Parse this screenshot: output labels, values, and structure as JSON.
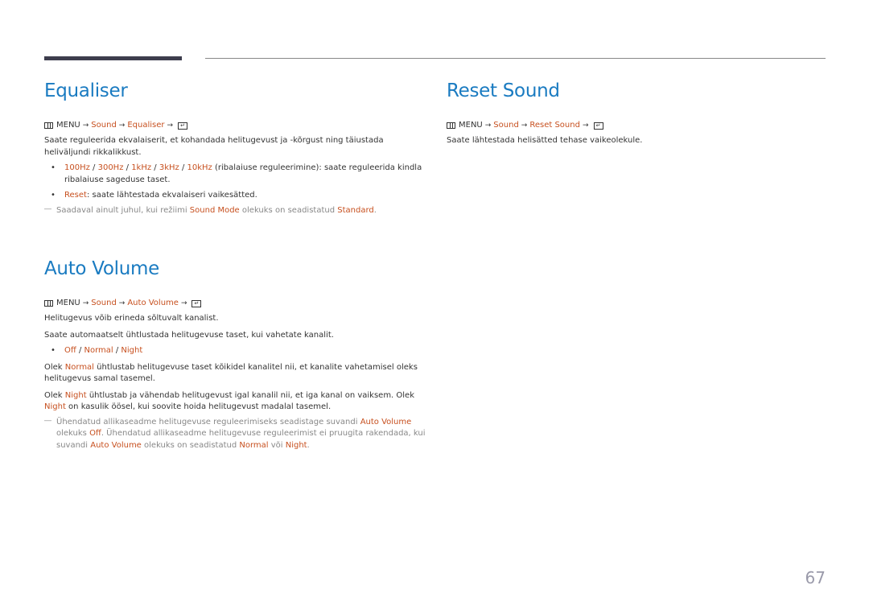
{
  "page_number": "67",
  "equaliser": {
    "title": "Equaliser",
    "menu": {
      "menu": "MENU",
      "arrow": "→",
      "path": [
        "Sound",
        "Equaliser"
      ]
    },
    "intro": "Saate reguleerida ekvalaiserit, et kohandada helitugevust ja -kõrgust ning täiustada heliväljundi rikkalikkust.",
    "bullets": [
      {
        "options": [
          "100Hz",
          "300Hz",
          "1kHz",
          "3kHz",
          "10kHz"
        ],
        "separator": " / ",
        "text": " (ribalaiuse reguleerimine): saate reguleerida kindla ribalaiuse sageduse taset."
      },
      {
        "options": [
          "Reset"
        ],
        "text": ": saate lähtestada ekvalaiseri vaikesätted."
      }
    ],
    "note": {
      "pre": "Saadaval ainult juhul, kui režiimi ",
      "hl1": "Sound Mode",
      "mid": " olekuks on seadistatud ",
      "hl2": "Standard",
      "post": "."
    }
  },
  "reset_sound": {
    "title": "Reset Sound",
    "menu": {
      "menu": "MENU",
      "arrow": "→",
      "path": [
        "Sound",
        "Reset Sound"
      ]
    },
    "text": "Saate lähtestada helisätted tehase vaikeolekule."
  },
  "auto_volume": {
    "title": "Auto Volume",
    "menu": {
      "menu": "MENU",
      "arrow": "→",
      "path": [
        "Sound",
        "Auto Volume"
      ]
    },
    "para1": "Helitugevus võib erineda sõltuvalt kanalist.",
    "para2": "Saate automaatselt ühtlustada helitugevuse taset, kui vahetate kanalit.",
    "options": [
      "Off",
      "Normal",
      "Night"
    ],
    "normal_para": {
      "pre": "Olek ",
      "hl": "Normal",
      "post": " ühtlustab helitugevuse taset kõikidel kanalitel nii, et kanalite vahetamisel oleks helitugevus samal tasemel."
    },
    "night_para": {
      "pre": "Olek ",
      "hl": "Night",
      "mid": " ühtlustab ja vähendab helitugevust igal kanalil nii, et iga kanal on vaiksem. Olek ",
      "hl2": "Night",
      "post": " on kasulik öösel, kui soovite hoida helitugevust madalal tasemel."
    },
    "note": {
      "t1": "Ühendatud allikaseadme helitugevuse reguleerimiseks seadistage suvandi ",
      "h1": "Auto Volume",
      "t2": " olekuks ",
      "h2": "Off",
      "t3": ". Ühendatud allikaseadme helitugevuse reguleerimist ei pruugita rakendada, kui suvandi ",
      "h3": "Auto Volume",
      "t4": " olekuks on seadistatud ",
      "h4": "Normal",
      "t5": " või ",
      "h5": "Night",
      "t6": "."
    }
  }
}
